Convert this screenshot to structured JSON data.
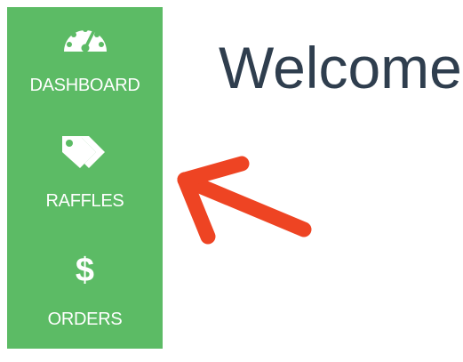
{
  "sidebar": {
    "background": "#5cbb65",
    "items": [
      {
        "icon": "speedometer-icon",
        "label": "DASHBOARD"
      },
      {
        "icon": "tags-icon",
        "label": "RAFFLES"
      },
      {
        "icon": "dollar-icon",
        "glyph": "$",
        "label": "ORDERS"
      }
    ]
  },
  "main": {
    "title": "Welcome"
  },
  "annotation": {
    "arrow_color": "#ee4423"
  }
}
